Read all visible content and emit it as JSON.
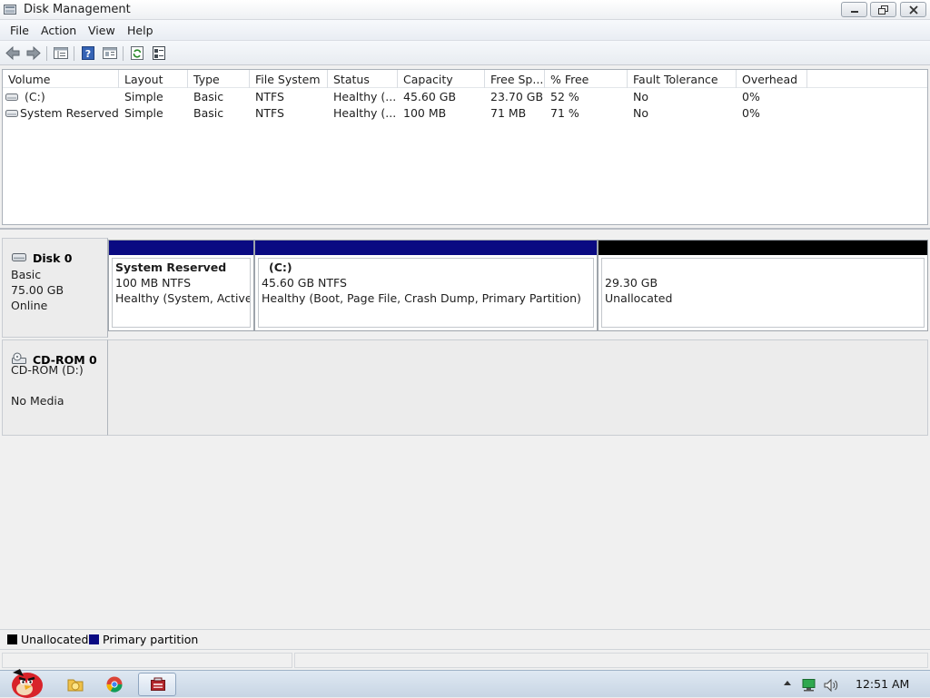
{
  "window": {
    "title": "Disk Management"
  },
  "menu": {
    "file": "File",
    "action": "Action",
    "view": "View",
    "help": "Help"
  },
  "toolbar": {
    "buttons": [
      "back-icon",
      "forward-icon",
      "show-hide-console-tree-icon",
      "help-icon",
      "properties-icon",
      "refresh-icon",
      "export-list-icon"
    ]
  },
  "volume_list": {
    "columns": [
      "Volume",
      "Layout",
      "Type",
      "File System",
      "Status",
      "Capacity",
      "Free Sp...",
      "% Free",
      "Fault Tolerance",
      "Overhead"
    ],
    "rows": [
      {
        "volume": "(C:)",
        "layout": "Simple",
        "type": "Basic",
        "file_system": "NTFS",
        "status": "Healthy (...",
        "capacity": "45.60 GB",
        "free_space": "23.70 GB",
        "percent_free": "52 %",
        "fault_tolerance": "No",
        "overhead": "0%"
      },
      {
        "volume": "System Reserved",
        "layout": "Simple",
        "type": "Basic",
        "file_system": "NTFS",
        "status": "Healthy (...",
        "capacity": "100 MB",
        "free_space": "71 MB",
        "percent_free": "71 %",
        "fault_tolerance": "No",
        "overhead": "0%"
      }
    ]
  },
  "disks": [
    {
      "name": "Disk 0",
      "type": "Basic",
      "size": "75.00 GB",
      "state": "Online",
      "partitions": [
        {
          "title": "System Reserved",
          "size": "100 MB NTFS",
          "status": "Healthy (System, Active, P",
          "kind": "primary"
        },
        {
          "title": "(C:)",
          "size": "45.60 GB NTFS",
          "status": "Healthy (Boot, Page File, Crash Dump, Primary Partition)",
          "kind": "primary"
        },
        {
          "title": "",
          "size": "29.30 GB",
          "status": "Unallocated",
          "kind": "unallocated"
        }
      ]
    },
    {
      "name": "CD-ROM 0",
      "drive": "CD-ROM (D:)",
      "state": "No Media"
    }
  ],
  "legend": {
    "unallocated": "Unallocated",
    "primary": "Primary partition"
  },
  "colors": {
    "primary": "#0a0a82",
    "unallocated": "#000000"
  },
  "taskbar": {
    "clock": "12:51 AM"
  }
}
